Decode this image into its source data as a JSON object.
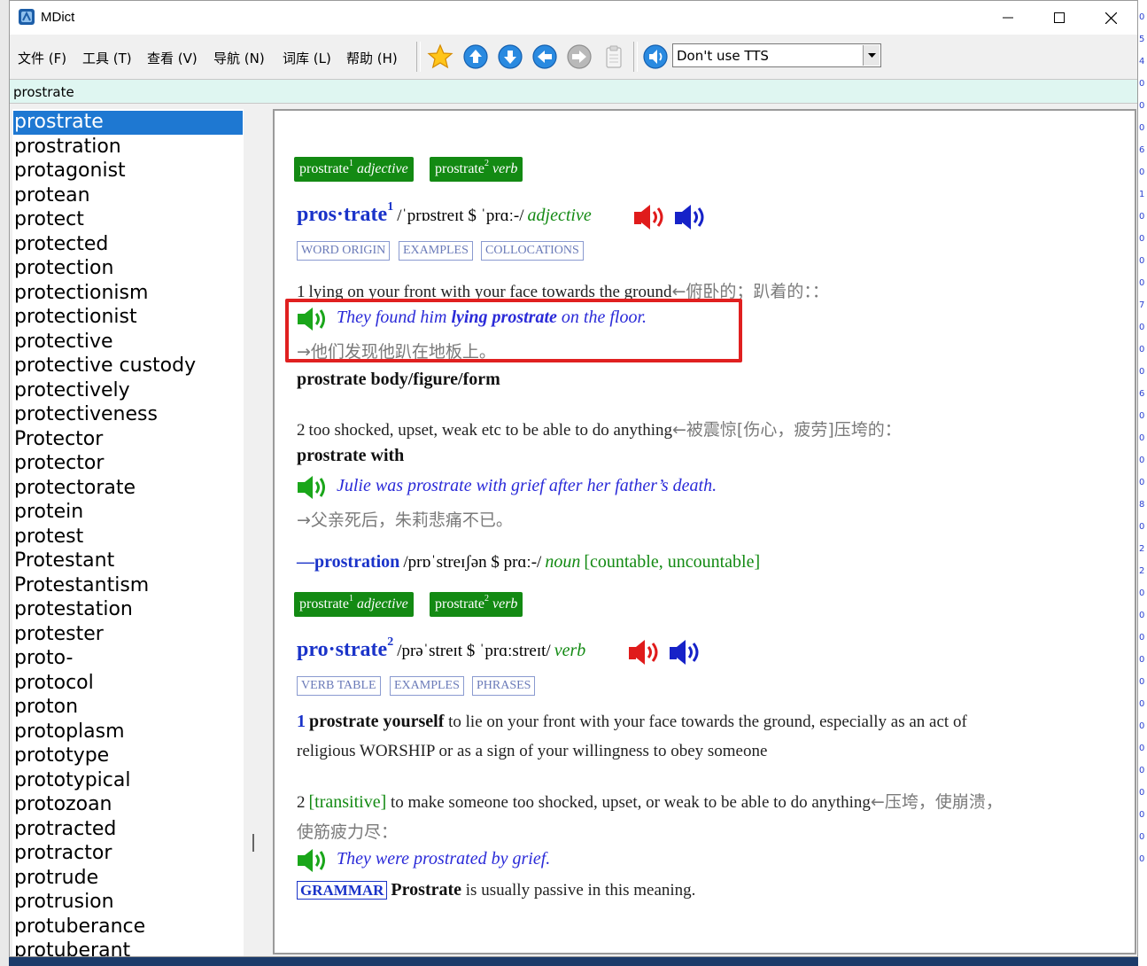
{
  "window": {
    "title": "MDict"
  },
  "menu": [
    "文件 (F)",
    "工具 (T)",
    "查看 (V)",
    "导航 (N)",
    "词库 (L)",
    "帮助 (H)"
  ],
  "tts": {
    "selected": "Don't use TTS"
  },
  "search": {
    "value": "prostrate"
  },
  "word_list": [
    "prostrate",
    "prostration",
    "protagonist",
    "protean",
    "protect",
    "protected",
    "protection",
    "protectionism",
    "protectionist",
    "protective",
    "protective custody",
    "protectively",
    "protectiveness",
    "Protector",
    "protector",
    "protectorate",
    "protein",
    "protest",
    "Protestant",
    "Protestantism",
    "protestation",
    "protester",
    "proto-",
    "protocol",
    "proton",
    "protoplasm",
    "prototype",
    "prototypical",
    "protozoan",
    "protracted",
    "protractor",
    "protrude",
    "protrusion",
    "protuberance",
    "protuberant"
  ],
  "selected_word": "prostrate",
  "entry": {
    "tags_1": [
      {
        "word": "prostrate",
        "sup": "1",
        "pos": "adjective"
      },
      {
        "word": "prostrate",
        "sup": "2",
        "pos": "verb"
      }
    ],
    "tags_2": [
      {
        "word": "prostrate",
        "sup": "1",
        "pos": "adjective"
      },
      {
        "word": "prostrate",
        "sup": "2",
        "pos": "verb"
      }
    ],
    "h1": {
      "word": "pros·trate",
      "sup": "1",
      "pron": "/ˈprɒstreɪt $ ˈprɑː-/",
      "pos": "adjective"
    },
    "h1_boxes": [
      "WORD ORIGIN",
      "EXAMPLES",
      "COLLOCATIONS"
    ],
    "sense1": {
      "num": "1",
      "def": "lying on your front with your face towards the ground",
      "zh": "←俯卧的；趴着的：：",
      "ex_a": "They found him ",
      "ex_b": "lying prostrate",
      "ex_c": " on the floor.",
      "ex_zh": "→他们发现他趴在地板上。"
    },
    "phrase1": "prostrate body/figure/form",
    "sense2": {
      "num": "2",
      "def": "too shocked, upset, weak etc to be able to do anything",
      "zh": "←被震惊[伤心，疲劳]压垮的：",
      "phrase": "prostrate with",
      "ex": "Julie was prostrate with grief after her father’s death.",
      "ex_zh": "→父亲死后，朱莉悲痛不已。"
    },
    "deriv": {
      "dash": "—",
      "word": "prostration",
      "pron": "/prɒˈstreɪʃən $ prɑː-/",
      "pos": "noun",
      "grammar": "[countable, uncountable]"
    },
    "h2": {
      "word": "pro·strate",
      "sup": "2",
      "pron": "/prəˈstreɪt $ ˈprɑːstreɪt/",
      "pos": "verb"
    },
    "h2_boxes": [
      "VERB TABLE",
      "EXAMPLES",
      "PHRASES"
    ],
    "vsense1": {
      "num": "1",
      "phrase": "prostrate yourself",
      "def": " to lie on your front with your face towards the ground, especially as an act of",
      "def2": "religious WORSHIP or as a sign of your willingness to obey someone"
    },
    "vsense2": {
      "num": "2",
      "trans": "[transitive]",
      "def": " to make someone too shocked, upset, or weak to be able to do anything",
      "zh": "←压垮，使崩溃，",
      "zh2": "使筋疲力尽：",
      "ex": "They were prostrated by grief."
    },
    "grammar_note": {
      "label": "GRAMMAR",
      "word": "Prostrate",
      "text": " is usually passive in this meaning."
    }
  },
  "right_strip_chars": [
    "0",
    "5",
    "4",
    "0",
    "0",
    "0",
    "6",
    "0",
    "1",
    "0",
    "0",
    "0",
    "0",
    "7",
    "0",
    "0",
    "0",
    "6",
    "0",
    "0",
    "0",
    "0",
    "8",
    "0",
    "2",
    "2",
    "0",
    "0",
    "0",
    "0",
    "0",
    "0",
    "0",
    "0",
    "0",
    "0",
    "0",
    "0",
    "0"
  ]
}
